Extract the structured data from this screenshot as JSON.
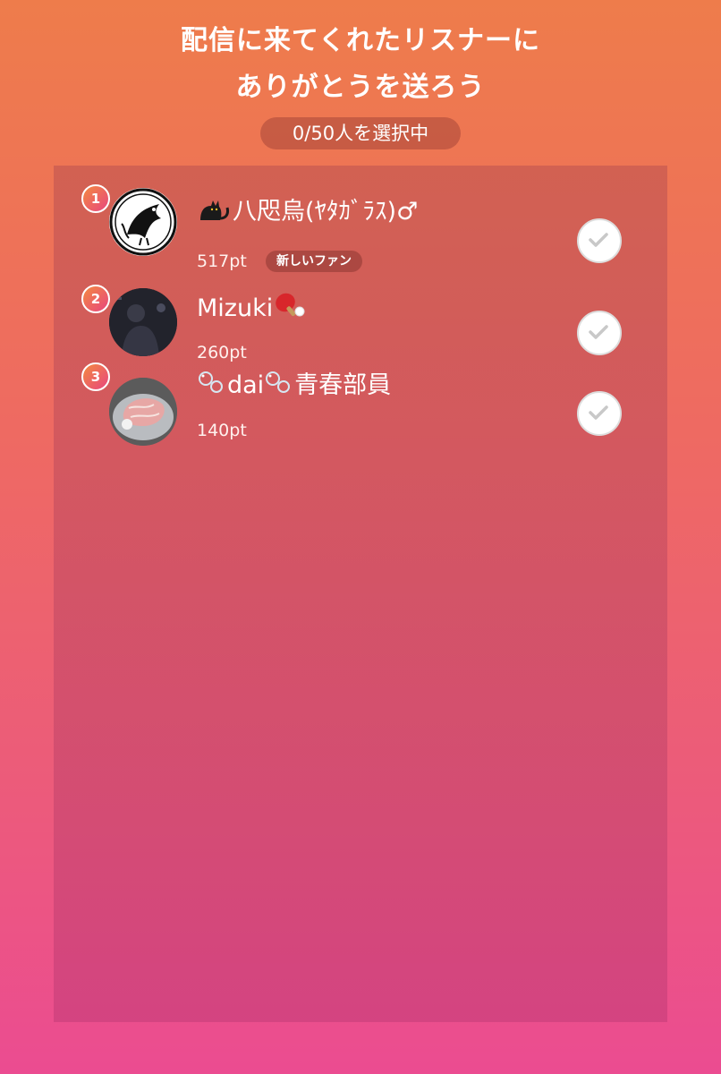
{
  "header": {
    "title_line1": "配信に来てくれたリスナーに",
    "title_line2": "ありがとうを送ろう",
    "counter": "0/50人を選択中"
  },
  "listeners": [
    {
      "rank": "1",
      "name": "八咫烏(ﾔﾀｶﾞﾗｽ)♂",
      "name_prefix_icon": "black-cat-emoji",
      "points": "517pt",
      "badge": "新しいファン",
      "avatar_icon": "crow-crest-avatar",
      "selected": false
    },
    {
      "rank": "2",
      "name": "Mizuki",
      "name_suffix_icon": "ping-pong-emoji",
      "points": "260pt",
      "avatar_icon": "dark-photo-avatar",
      "selected": false
    },
    {
      "rank": "3",
      "name_parts": [
        "dai",
        "青春部員"
      ],
      "decoration_icon": "bubbles-emoji",
      "points": "140pt",
      "avatar_icon": "wagyu-beef-photo-avatar",
      "selected": false
    }
  ],
  "colors": {
    "gradient_top": "#ee7c4b",
    "gradient_bottom": "#eb4c91",
    "rank_badge_start": "#f38a40",
    "rank_badge_end": "#e8457f"
  }
}
